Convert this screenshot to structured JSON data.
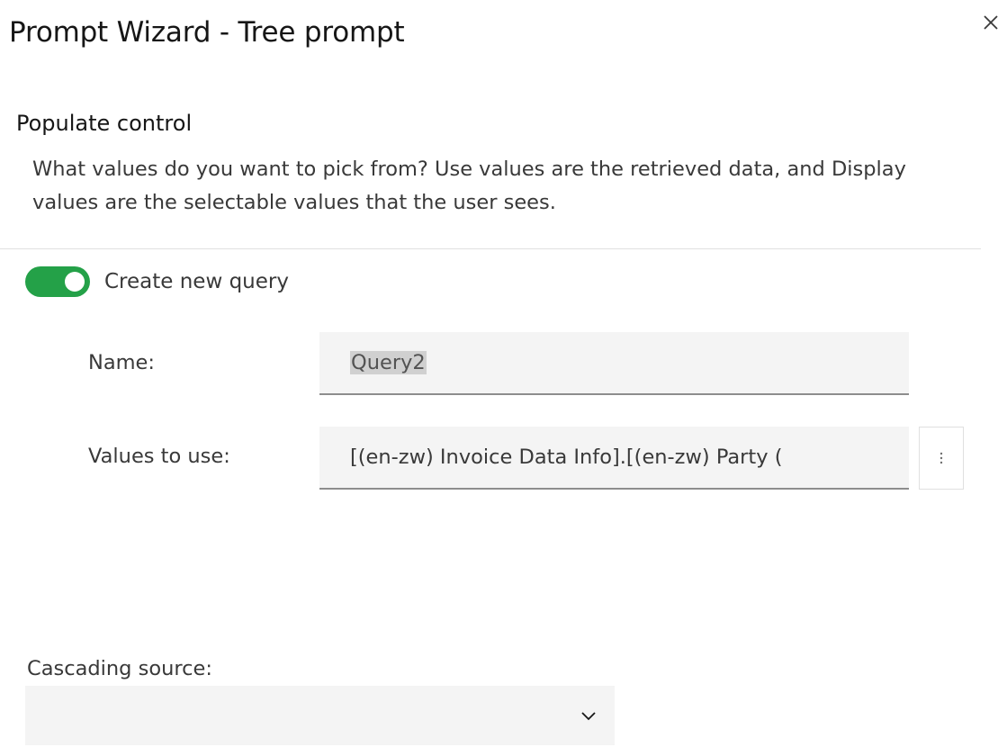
{
  "dialog": {
    "title": "Prompt Wizard - Tree prompt",
    "close_icon": "close-icon"
  },
  "section": {
    "heading": "Populate control",
    "description": "What values do you want to pick from? Use values are the retrieved data, and Display values are the selectable values that the user sees."
  },
  "toggle": {
    "label": "Create new query",
    "checked": true,
    "color": "#24a148"
  },
  "fields": {
    "name": {
      "label": "Name:",
      "value": "Query2"
    },
    "values_to_use": {
      "label": "Values to use:",
      "value": "[(en-zw) Invoice Data Info].[(en-zw) Party (",
      "more_icon": "overflow-menu-vertical-icon"
    }
  },
  "cascading": {
    "label": "Cascading source:",
    "selected": "",
    "chevron_icon": "chevron-down-icon"
  }
}
